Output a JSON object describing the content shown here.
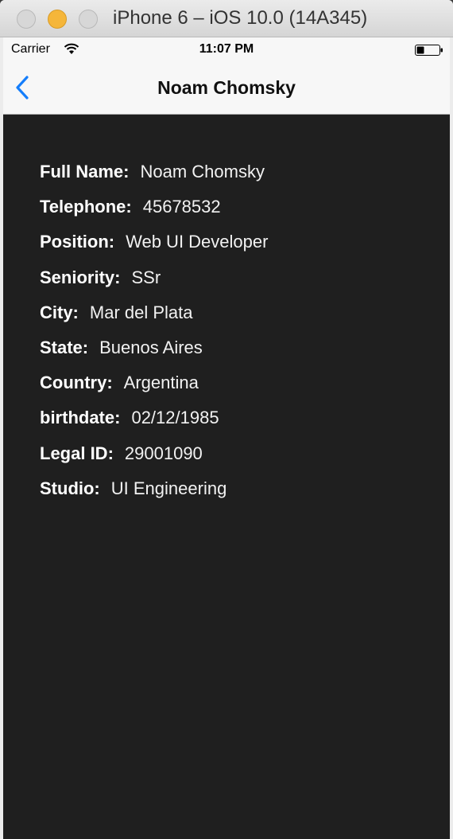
{
  "window": {
    "title": "iPhone 6 – iOS 10.0 (14A345)"
  },
  "status_bar": {
    "carrier": "Carrier",
    "time": "11:07 PM",
    "icons": [
      "wifi-icon",
      "battery-icon"
    ]
  },
  "nav": {
    "back_icon": "chevron-left-icon",
    "title": "Noam Chomsky",
    "accent": "#157efb"
  },
  "details": [
    {
      "label": "Full Name:",
      "value": "Noam Chomsky"
    },
    {
      "label": "Telephone:",
      "value": "45678532"
    },
    {
      "label": "Position:",
      "value": "Web UI Developer"
    },
    {
      "label": "Seniority:",
      "value": "SSr"
    },
    {
      "label": "City:",
      "value": "Mar del Plata"
    },
    {
      "label": "State:",
      "value": "Buenos Aires"
    },
    {
      "label": "Country:",
      "value": "Argentina"
    },
    {
      "label": "birthdate:",
      "value": "02/12/1985"
    },
    {
      "label": "Legal ID:",
      "value": "29001090"
    },
    {
      "label": "Studio:",
      "value": "UI Engineering"
    }
  ],
  "colors": {
    "background": "#1f1f1f",
    "bar": "#f7f7f7",
    "text": "#ffffff"
  }
}
